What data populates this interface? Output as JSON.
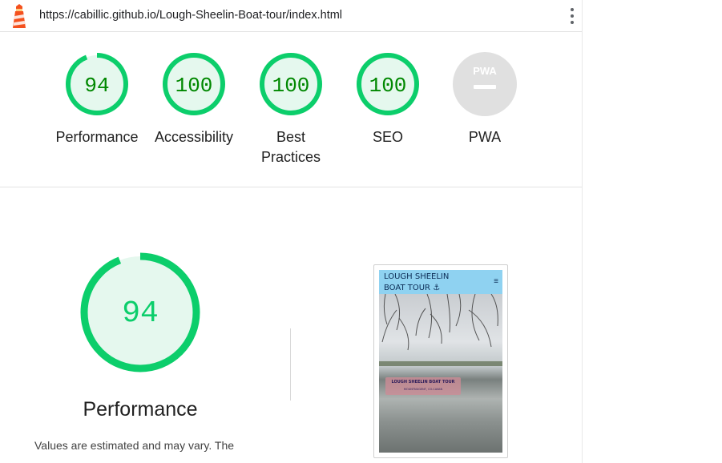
{
  "topbar": {
    "url": "https://cabillic.github.io/Lough-Sheelin-Boat-tour/index.html"
  },
  "gauges": [
    {
      "label": "Performance",
      "score": "94",
      "value": 94
    },
    {
      "label": "Accessibility",
      "score": "100",
      "value": 100
    },
    {
      "label": "Best Practices",
      "score": "100",
      "value": 100
    },
    {
      "label": "SEO",
      "score": "100",
      "value": 100
    },
    {
      "label": "PWA",
      "badge": "PWA"
    }
  ],
  "colors": {
    "pass": "#0cce6b",
    "pass_text": "#008800",
    "pass_fill": "#e5f8ee",
    "pwa_gray": "#e0e0e0",
    "logo_orange": "#f4511e"
  },
  "performance": {
    "score": "94",
    "value": 94,
    "title": "Performance",
    "description": "Values are estimated and may vary. The"
  },
  "screenshot": {
    "site_title_line1": "LOUGH SHEELIN",
    "site_title_line2": "BOAT TOUR ⚓",
    "menu_icon": "≡",
    "banner_title": "LOUGH SHEELIN BOAT TOUR",
    "banner_subtitle": "MOUNTNUGENT, CO.CAVAN"
  }
}
